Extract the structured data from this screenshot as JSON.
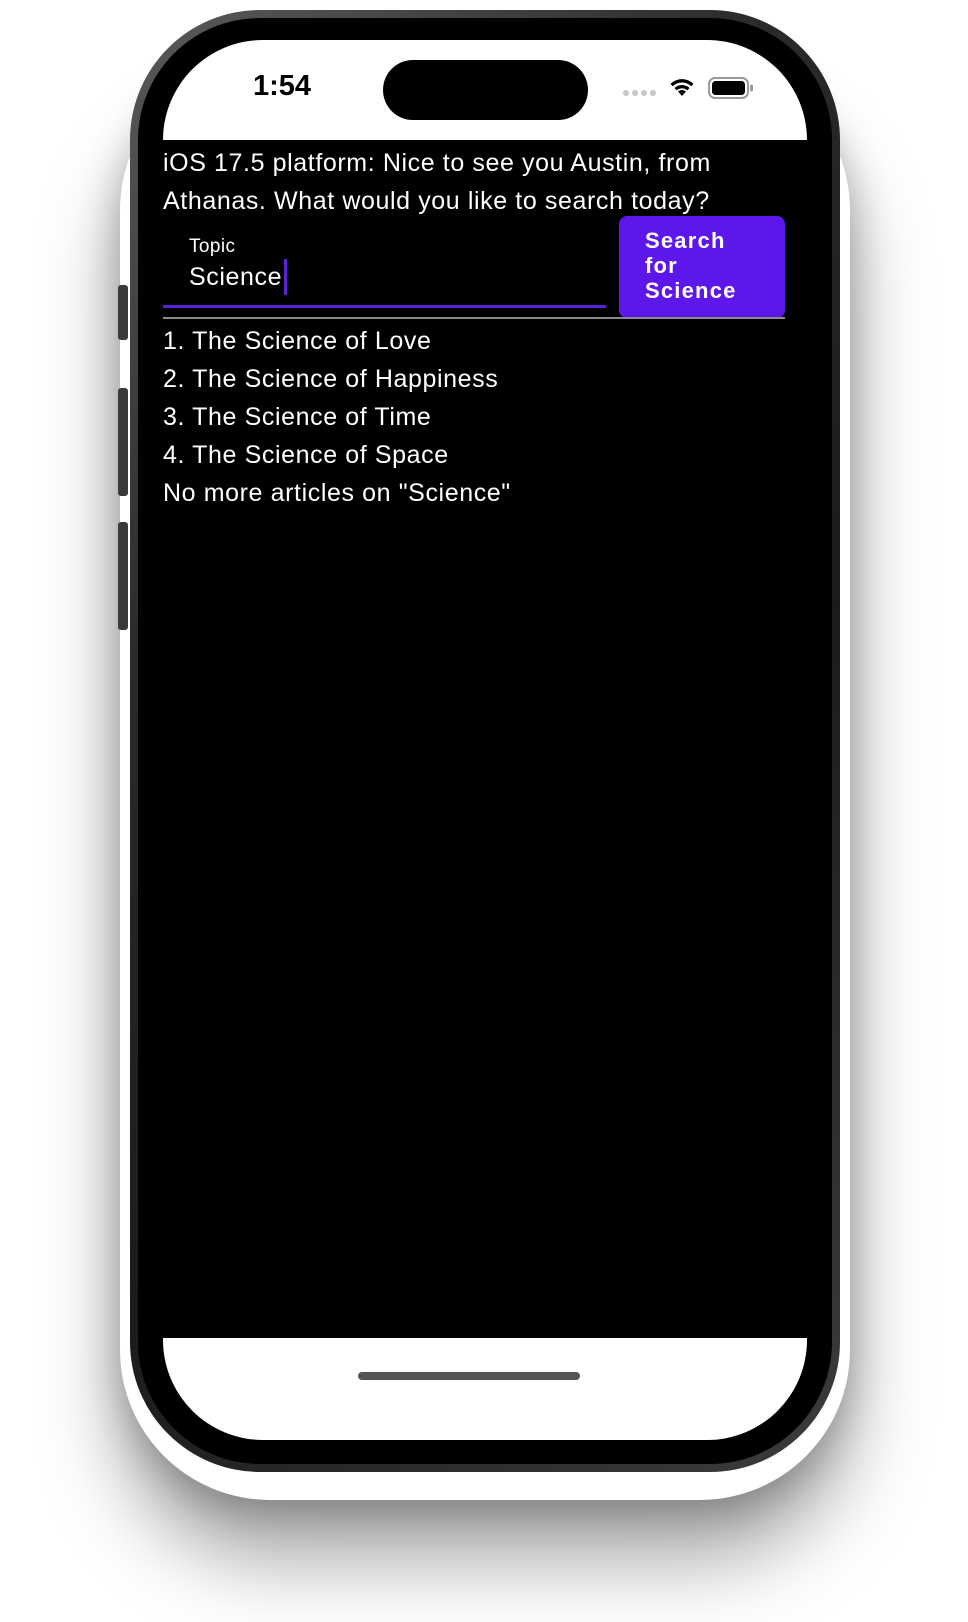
{
  "status_bar": {
    "time": "1:54",
    "icons": [
      "cellular-signal-icon",
      "wifi-icon",
      "battery-icon"
    ]
  },
  "greeting": "iOS 17.5 platform: Nice to see you Austin, from Athanas. What would you like to search today?",
  "search": {
    "label": "Topic",
    "value": "Science",
    "button_label": "Search\nfor\nScience"
  },
  "results": [
    "1. The Science of Love",
    "2. The Science of Happiness",
    "3. The Science of Time",
    "4. The Science of Space",
    "No more articles on \"Science\""
  ],
  "colors": {
    "accent": "#5E17EB",
    "background": "#000000",
    "text": "#FFFFFF"
  }
}
